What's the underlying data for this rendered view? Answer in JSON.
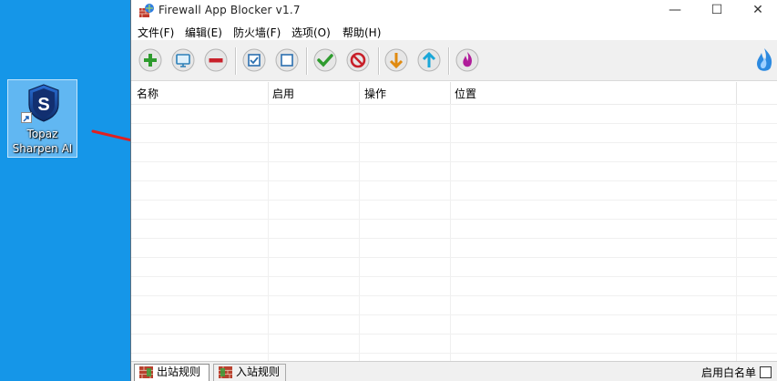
{
  "desktop": {
    "shortcut_label_line1": "Topaz",
    "shortcut_label_line2": "Sharpen AI"
  },
  "window": {
    "title": "Firewall App Blocker v1.7",
    "controls": {
      "minimize": "—",
      "maximize": "☐",
      "close": "✕"
    }
  },
  "menu": [
    {
      "label": "文件(F)"
    },
    {
      "label": "编辑(E)"
    },
    {
      "label": "防火墙(F)"
    },
    {
      "label": "选项(O)"
    },
    {
      "label": "帮助(H)"
    }
  ],
  "toolbar": {
    "buttons": [
      {
        "name": "add",
        "icon": "plus-icon",
        "color": "#2e9b2e"
      },
      {
        "name": "computer",
        "icon": "monitor-icon",
        "color": "#2b7fb8"
      },
      {
        "name": "remove",
        "icon": "minus-icon",
        "color": "#c8202a"
      },
      {
        "name": "check-all",
        "icon": "checkbox-checked-icon",
        "color": "#2b6fb0"
      },
      {
        "name": "uncheck-all",
        "icon": "checkbox-empty-icon",
        "color": "#2b6fb0"
      },
      {
        "name": "allow",
        "icon": "checkmark-icon",
        "color": "#2e9b2e"
      },
      {
        "name": "block",
        "icon": "prohibited-icon",
        "color": "#c8202a"
      },
      {
        "name": "import",
        "icon": "arrow-down-icon",
        "color": "#e08a10"
      },
      {
        "name": "export",
        "icon": "arrow-up-icon",
        "color": "#1aa7d8"
      },
      {
        "name": "firewall",
        "icon": "flame-icon",
        "color": "#b01c9a"
      }
    ]
  },
  "table": {
    "columns": [
      "名称",
      "启用",
      "操作",
      "位置"
    ],
    "rows": []
  },
  "tabs": [
    {
      "label": "出站规则"
    },
    {
      "label": "入站规则"
    }
  ],
  "status": {
    "whitelist_label": "启用白名单",
    "whitelist_checked": false
  },
  "colors": {
    "desktop_bg": "#1596e8",
    "arrow": "#e02020",
    "toolbar_bg": "#f0f0f0"
  }
}
